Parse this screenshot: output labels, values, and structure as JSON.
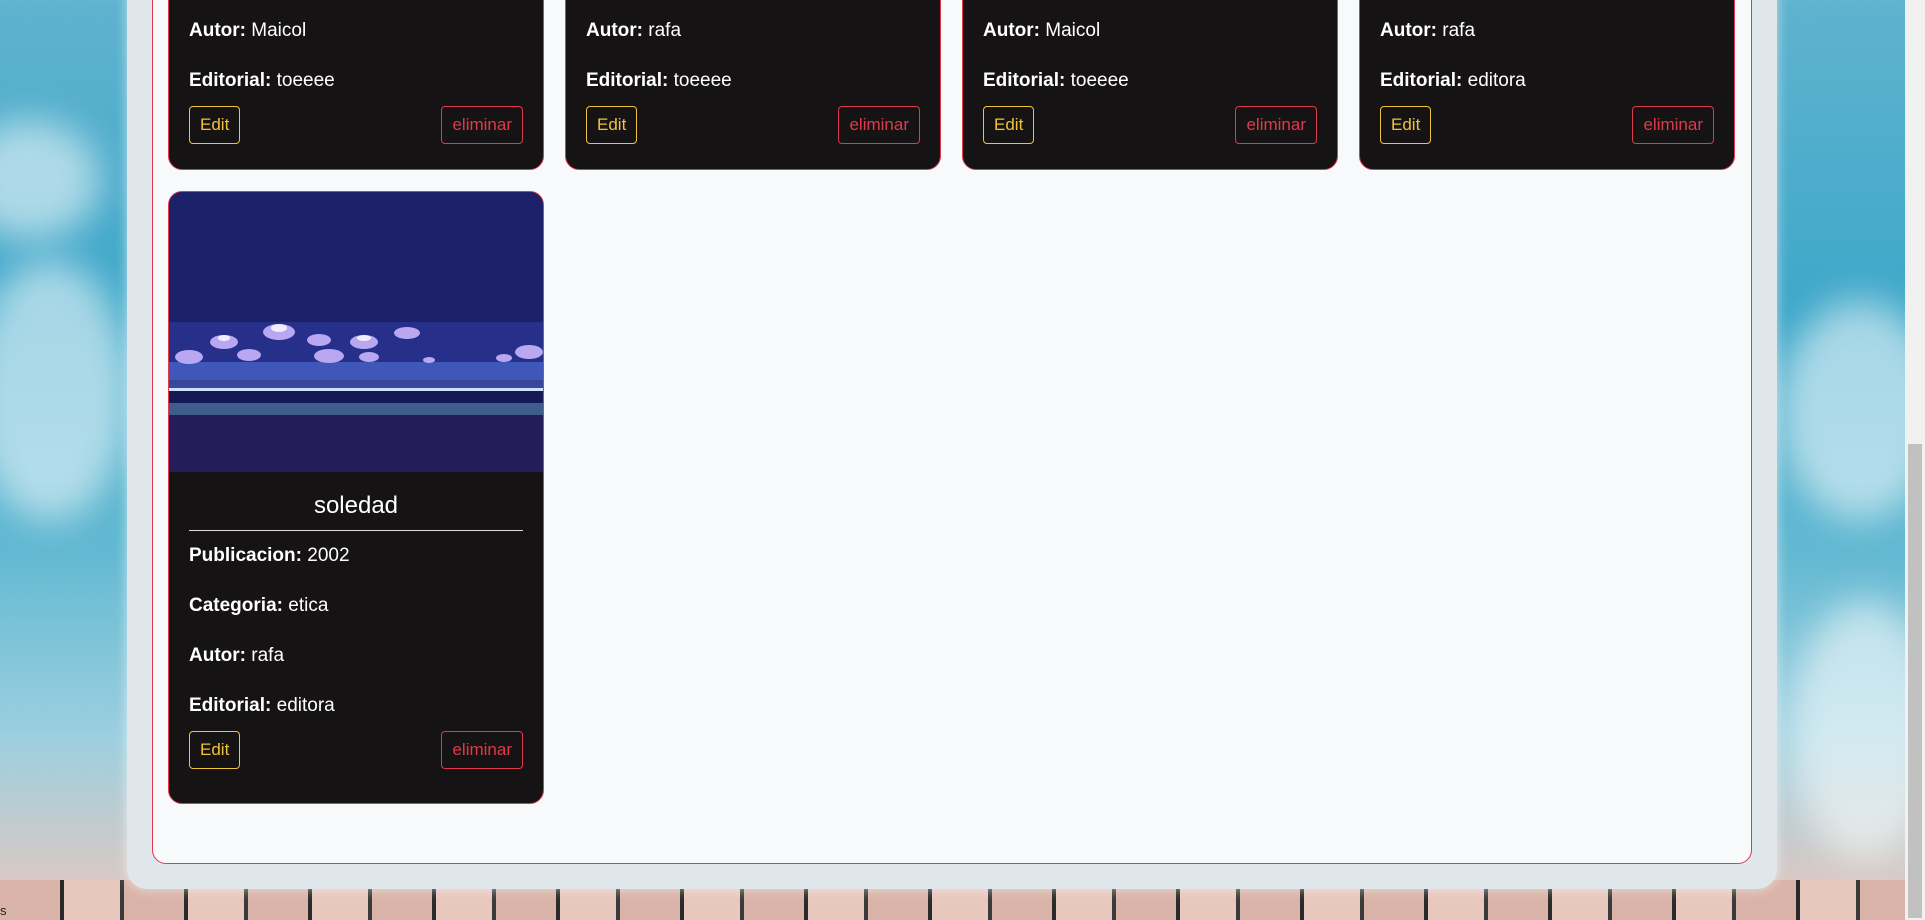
{
  "cards": [
    {
      "autor": "Maicol",
      "editorial": "toeeee"
    },
    {
      "autor": "rafa",
      "editorial": "toeeee"
    },
    {
      "autor": "Maicol",
      "editorial": "toeeee"
    },
    {
      "autor": "rafa",
      "editorial": "editora"
    }
  ],
  "featured": {
    "title": "soledad",
    "publicacion": "2002",
    "categoria": "etica",
    "autor": "rafa",
    "editorial": "editora"
  },
  "labels": {
    "publicacion": "Publicacion:",
    "categoria": "Categoria:",
    "autor": "Autor:",
    "editorial": "Editorial:",
    "edit": "Edit",
    "eliminar": "eliminar"
  },
  "status_text": "s",
  "colors": {
    "accent_red": "#e0394b",
    "accent_yellow": "#f2c23a",
    "card_bg": "#161315"
  }
}
